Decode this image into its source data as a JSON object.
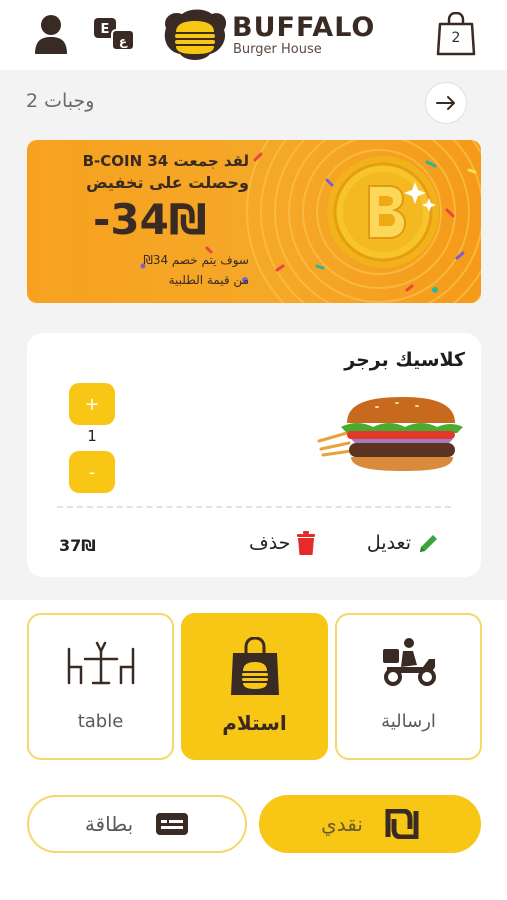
{
  "header": {
    "brand": "BUFFALO",
    "brand_sub": "Burger House",
    "cart_count": "2",
    "lang_glyph_en": "E",
    "lang_glyph_ar": "ع"
  },
  "meals": {
    "label": "وجبات 2"
  },
  "promo": {
    "line1": "لقد جمعت B-COIN 34",
    "line2": "وحصلت على تخفيض",
    "amount": "-34₪",
    "sub1": "سوف يتم خصم 34₪",
    "sub2": "من قيمة الطلبية"
  },
  "product": {
    "name": "كلاسيك برجر",
    "plus": "+",
    "minus": "-",
    "quantity": "1",
    "edit_label": "تعديل",
    "delete_label": "حذف",
    "price": "37₪"
  },
  "order_types": {
    "table": "table",
    "pickup": "استلام",
    "delivery": "ارسالية"
  },
  "payment": {
    "card": "بطاقة",
    "cash": "نقدي"
  },
  "colors": {
    "accent": "#f8c615",
    "promo": "#f7a11f",
    "dark": "#3a2a24"
  }
}
